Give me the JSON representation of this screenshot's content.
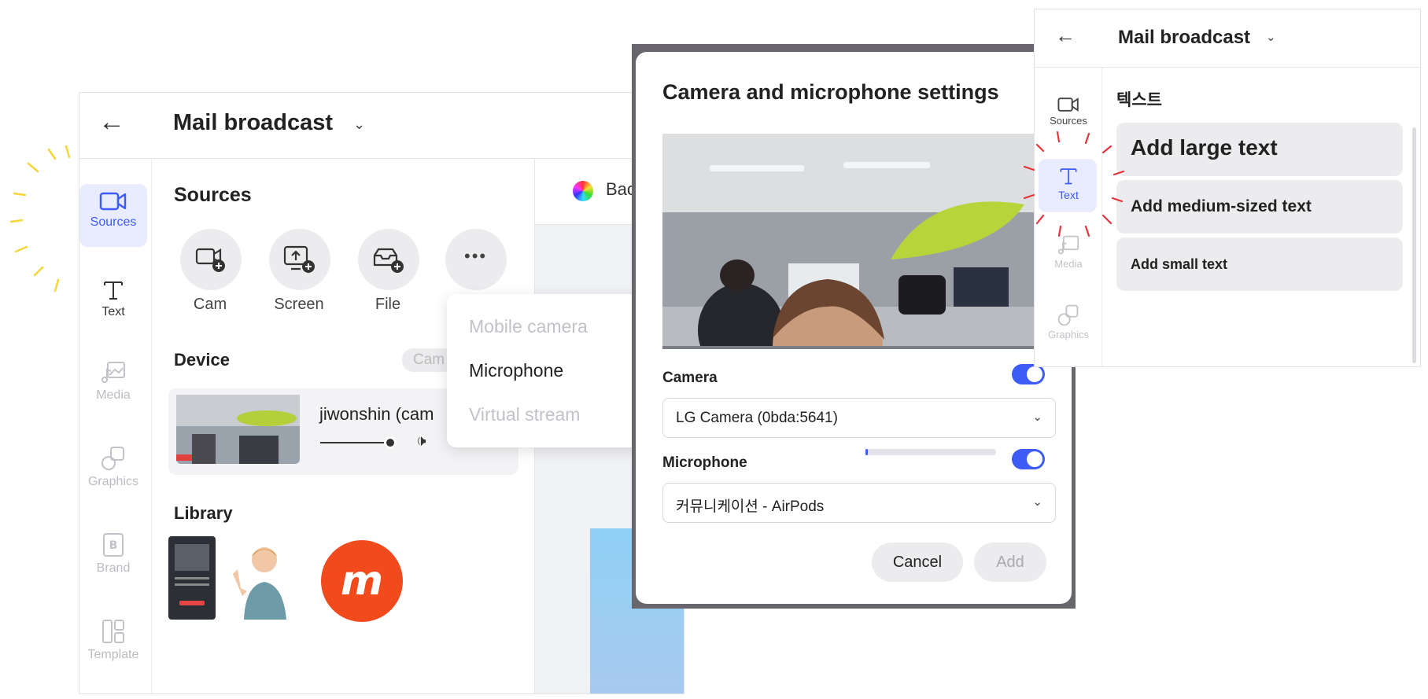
{
  "main": {
    "title": "Mail broadcast",
    "rail": [
      {
        "label": "Sources",
        "icon": "video-camera-icon"
      },
      {
        "label": "Text",
        "icon": "text-icon"
      },
      {
        "label": "Media",
        "icon": "media-icon"
      },
      {
        "label": "Graphics",
        "icon": "shapes-icon"
      },
      {
        "label": "Brand",
        "icon": "brand-icon"
      },
      {
        "label": "Template",
        "icon": "template-icon"
      }
    ],
    "sources_heading": "Sources",
    "source_buttons": [
      {
        "label": "Cam",
        "icon": "camera-add-icon"
      },
      {
        "label": "Screen",
        "icon": "screen-add-icon"
      },
      {
        "label": "File",
        "icon": "file-add-icon"
      },
      {
        "label": "",
        "icon": "more-icon"
      }
    ],
    "device_heading": "Device",
    "device_chip": "Cam",
    "device_name": "jiwonshin (cam",
    "library_heading": "Library",
    "background_label": "Bac",
    "dropdown": [
      {
        "label": "Mobile camera",
        "enabled": false
      },
      {
        "label": "Microphone",
        "enabled": true
      },
      {
        "label": "Virtual stream",
        "enabled": false
      }
    ]
  },
  "dialog": {
    "title": "Camera and microphone settings",
    "camera_label": "Camera",
    "camera_enabled": true,
    "camera_value": "LG Camera (0bda:5641)",
    "microphone_label": "Microphone",
    "microphone_enabled": true,
    "microphone_value": "커뮤니케이션 - AirPods",
    "cancel_label": "Cancel",
    "add_label": "Add"
  },
  "text_panel": {
    "title": "Mail broadcast",
    "heading": "텍스트",
    "rail": [
      {
        "label": "Sources",
        "icon": "video-camera-icon"
      },
      {
        "label": "Text",
        "icon": "text-icon"
      },
      {
        "label": "Media",
        "icon": "media-icon"
      },
      {
        "label": "Graphics",
        "icon": "shapes-icon"
      }
    ],
    "options": [
      "Add large text",
      "Add medium-sized text",
      "Add small text"
    ]
  },
  "colors": {
    "accent": "#3d5bf5",
    "burst_yellow": "#f5d63b",
    "burst_red": "#e8323c"
  }
}
